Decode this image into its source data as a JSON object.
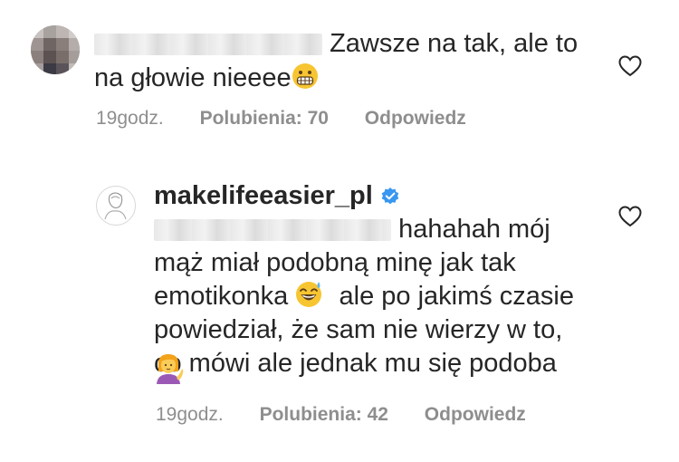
{
  "comments": [
    {
      "avatar_icon": "pixelated-avatar-icon",
      "username_blurred": true,
      "text_line1": "Zawsze na tak, ale to",
      "text_line2": "na głowie nieeee",
      "emoji": "grimacing-face-emoji",
      "time": "19godz.",
      "likes_label": "Polubienia: 70",
      "reply_label": "Odpowiedz",
      "like_icon": "heart-icon"
    },
    {
      "avatar_icon": "profile-avatar-icon",
      "username": "makelifeeasier_pl",
      "verified_icon": "verified-badge-icon",
      "mention_blurred": true,
      "text_line1": "hahahah mój",
      "text_line2": "mąż miał podobną minę jak tak",
      "text_line3a": "emotikonka",
      "text_line3b": "ale po jakimś czasie",
      "text_line4": "powiedział, że sam nie wierzy w to,",
      "text_line5": "co mówi ale jednak mu się podoba",
      "emoji1": "grinning-sweat-face-emoji",
      "emoji2": "person-tipping-hand-emoji",
      "time": "19godz.",
      "likes_label": "Polubienia: 42",
      "reply_label": "Odpowiedz",
      "like_icon": "heart-icon"
    }
  ],
  "colors": {
    "text": "#262626",
    "meta": "#8e8e8e",
    "verified": "#3897f0"
  }
}
